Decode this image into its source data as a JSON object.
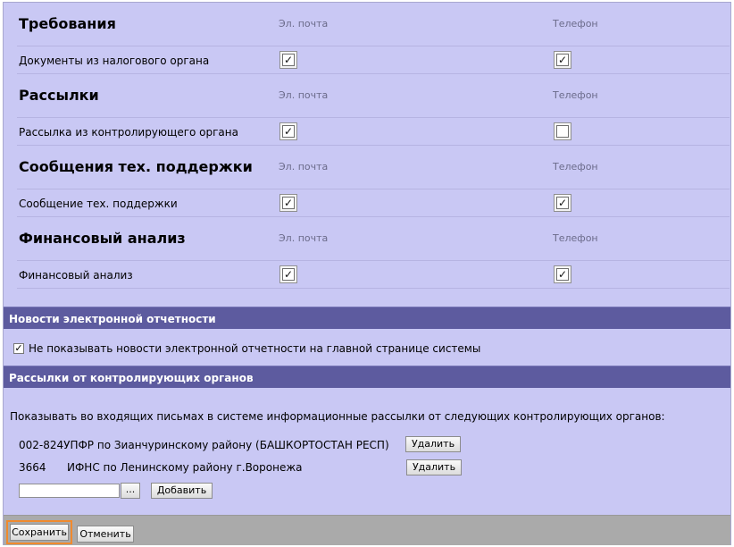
{
  "sections": [
    {
      "title": "Требования",
      "email_col": "Эл. почта",
      "phone_col": "Телефон",
      "row_label": "Документы из налогового органа",
      "email_checked": true,
      "phone_checked": true
    },
    {
      "title": "Рассылки",
      "email_col": "Эл. почта",
      "phone_col": "Телефон",
      "row_label": "Рассылка из контролирующего органа",
      "email_checked": true,
      "phone_checked": false
    },
    {
      "title": "Сообщения тех. поддержки",
      "email_col": "Эл. почта",
      "phone_col": "Телефон",
      "row_label": "Сообщение тех. поддержки",
      "email_checked": true,
      "phone_checked": true
    },
    {
      "title": "Финансовый анализ",
      "email_col": "Эл. почта",
      "phone_col": "Телефон",
      "row_label": "Финансовый анализ",
      "email_checked": true,
      "phone_checked": true
    }
  ],
  "news": {
    "header": "Новости электронной отчетности",
    "checkbox_label": "Не показывать новости электронной отчетности на главной странице системы",
    "checked": true
  },
  "mailings": {
    "header": "Рассылки от контролирующих органов",
    "intro": "Показывать во входящих письмах в системе информационные рассылки от следующих контролирующих органов:",
    "orgs": [
      {
        "text": "002-824УПФР по Зианчуринскому району (БАШКОРТОСТАН РЕСП)",
        "delete_label": "Удалить"
      },
      {
        "code": "3664",
        "name": "ИФНС по Ленинскому району г.Воронежа",
        "delete_label": "Удалить"
      }
    ],
    "input_value": "",
    "browse_label": "...",
    "add_label": "Добавить"
  },
  "footer": {
    "save_label": "Сохранить",
    "cancel_label": "Отменить"
  },
  "colors": {
    "panel": "#c9c8f4",
    "header_bar": "#5d5b9f",
    "footer": "#aaaaaa",
    "focus_outline": "#f08a2e"
  }
}
